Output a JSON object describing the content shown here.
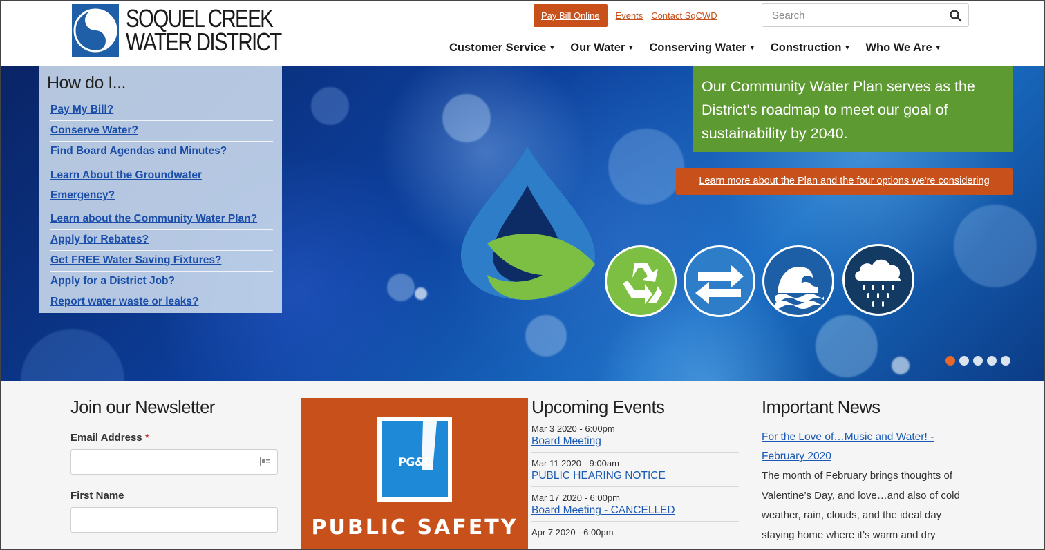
{
  "header": {
    "logo_line1": "SOQUEL CREEK",
    "logo_line2": "WATER DISTRICT",
    "pay_bill": "Pay Bill Online",
    "events": "Events",
    "contact": "Contact SqCWD",
    "search_placeholder": "Search",
    "nav": [
      "Customer Service",
      "Our Water",
      "Conserving Water",
      "Construction",
      "Who We Are"
    ]
  },
  "how_do_i": {
    "title": "How do I...",
    "links": [
      "Pay My Bill?",
      "Conserve Water?",
      "Find Board Agendas and Minutes?",
      "Learn About the Groundwater Emergency?",
      "Learn about the Community Water Plan?",
      "Apply for Rebates?",
      "Get FREE Water Saving Fixtures?",
      "Apply for a District Job?",
      "Report water waste or leaks?"
    ]
  },
  "hero": {
    "plan_text": "Our Community Water Plan serves as the District's roadmap to meet our goal of sustainability by 2040.",
    "plan_button": "Learn more about the Plan and the four options we're considering",
    "icons": [
      "recycle-icon",
      "exchange-icon",
      "waves-icon",
      "rain-cloud-icon"
    ],
    "colors": {
      "accent_orange": "#c8501a",
      "plan_green": "#5e9a32",
      "icon_green": "#7dbf43",
      "icon_blue": "#2e7dc8",
      "icon_navy": "#133a63"
    },
    "slide_active": 1,
    "slide_count": 5
  },
  "newsletter": {
    "title": "Join our Newsletter",
    "email_label": "Email Address",
    "required_mark": "*",
    "first_name_label": "First Name"
  },
  "pge": {
    "logo_text": "PG&E",
    "banner": "PUBLIC SAFETY"
  },
  "events": {
    "title": "Upcoming Events",
    "items": [
      {
        "date": "Mar 3 2020 - 6:00pm",
        "title": "Board Meeting"
      },
      {
        "date": "Mar 11 2020 - 9:00am",
        "title": "PUBLIC HEARING NOTICE"
      },
      {
        "date": "Mar 17 2020 - 6:00pm",
        "title": "Board Meeting - CANCELLED"
      },
      {
        "date": "Apr 7 2020 - 6:00pm",
        "title": ""
      }
    ]
  },
  "news": {
    "title": "Important News",
    "headline": "For the Love of…Music and Water! - February 2020",
    "body": "The month of February brings thoughts of Valentine’s Day, and love…and also of cold weather, rain, clouds, and the ideal day staying home where it’s warm and dry"
  }
}
